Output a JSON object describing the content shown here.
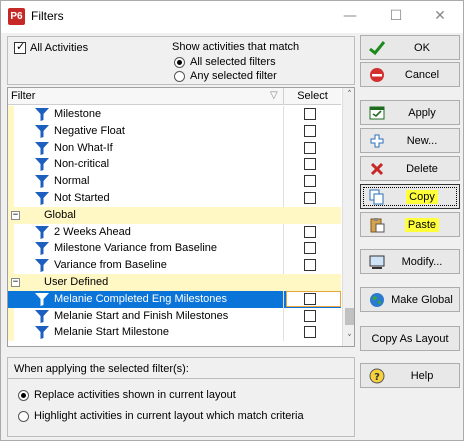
{
  "window": {
    "app_icon": "P6",
    "title": "Filters",
    "minimize": "—",
    "maximize": "☐",
    "close": "✕"
  },
  "top": {
    "all_activities_label": "All Activities",
    "all_activities_checked": true,
    "show_label": "Show activities that match",
    "options": [
      {
        "label": "All selected filters",
        "selected": true
      },
      {
        "label": "Any selected filter",
        "selected": false
      }
    ]
  },
  "grid": {
    "col_filter": "Filter",
    "col_select": "Select",
    "rows": [
      {
        "type": "item",
        "label": "Milestone",
        "checked": false
      },
      {
        "type": "item",
        "label": "Negative Float",
        "checked": false
      },
      {
        "type": "item",
        "label": "Non What-If",
        "checked": false
      },
      {
        "type": "item",
        "label": "Non-critical",
        "checked": false
      },
      {
        "type": "item",
        "label": "Normal",
        "checked": false
      },
      {
        "type": "item",
        "label": "Not Started",
        "checked": false
      },
      {
        "type": "group",
        "label": "Global",
        "toggle": "−"
      },
      {
        "type": "item",
        "label": "2 Weeks Ahead",
        "checked": false
      },
      {
        "type": "item",
        "label": "Milestone Variance from Baseline",
        "checked": false
      },
      {
        "type": "item",
        "label": "Variance from Baseline",
        "checked": false
      },
      {
        "type": "group",
        "label": "User Defined",
        "toggle": "−"
      },
      {
        "type": "item",
        "label": "Melanie Completed Eng Milestones",
        "checked": false,
        "selected": true
      },
      {
        "type": "item",
        "label": "Melanie Start and Finish Milestones",
        "checked": false
      },
      {
        "type": "item",
        "label": "Melanie Start Milestone",
        "checked": false
      }
    ]
  },
  "buttons": {
    "ok": "OK",
    "cancel": "Cancel",
    "apply": "Apply",
    "new": "New...",
    "delete": "Delete",
    "copy": "Copy",
    "paste": "Paste",
    "modify": "Modify...",
    "make_global": "Make Global",
    "copy_as_layout": "Copy As Layout",
    "help": "Help"
  },
  "bottom": {
    "heading": "When applying the selected filter(s):",
    "options": [
      {
        "label": "Replace activities shown in current layout",
        "selected": true
      },
      {
        "label": "Highlight activities in current layout which match criteria",
        "selected": false
      }
    ]
  },
  "colors": {
    "selection": "#0a74d8",
    "group_band": "#fff8c4",
    "highlight": "#ffff3a",
    "filter_icon": "#1c5fbf"
  }
}
